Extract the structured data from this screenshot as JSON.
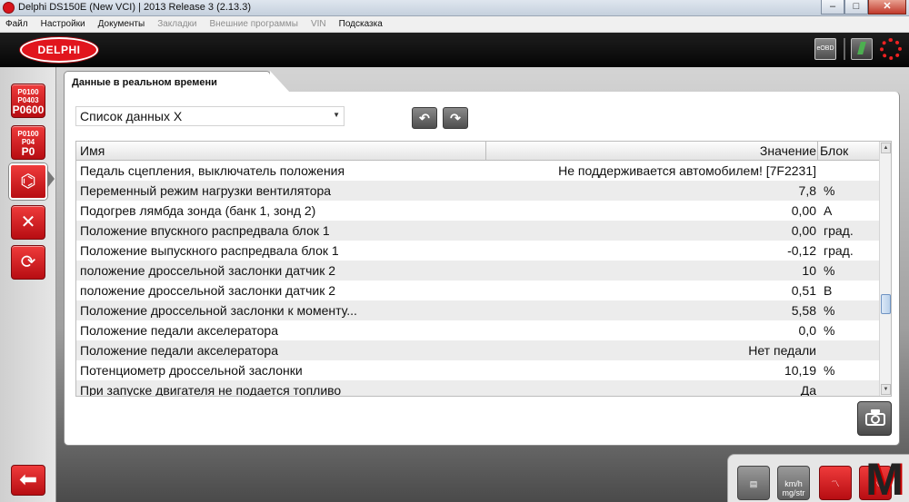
{
  "window": {
    "title": "Delphi DS150E (New VCI) | 2013 Release 3 (2.13.3)",
    "minimize": "–",
    "maximize": "□",
    "close": "✕"
  },
  "menu": [
    {
      "label": "Файл",
      "enabled": true
    },
    {
      "label": "Настройки",
      "enabled": true
    },
    {
      "label": "Документы",
      "enabled": true
    },
    {
      "label": "Закладки",
      "enabled": false
    },
    {
      "label": "Внешние программы",
      "enabled": false
    },
    {
      "label": "VIN",
      "enabled": false
    },
    {
      "label": "Подсказка",
      "enabled": true
    }
  ],
  "header": {
    "logo": "DELPHI",
    "obd_label": "eOBD"
  },
  "sidebar": {
    "dtc_read": {
      "line1": "P0100",
      "line2": "P0403",
      "line3": "P0600"
    },
    "dtc_clear": {
      "line1": "P0100",
      "line2": "P04",
      "line3": "P0"
    }
  },
  "tab": {
    "label": "Данные в реальном времени"
  },
  "selector": {
    "value": "Список данных X"
  },
  "table": {
    "columns": {
      "name": "Имя",
      "value": "Значение",
      "unit": "Блок"
    },
    "rows": [
      {
        "name": "Педаль сцепления, выключатель положения",
        "value": "Не поддерживается автомобилем! [7F2231]",
        "unit": ""
      },
      {
        "name": "Переменный режим нагрузки вентилятора",
        "value": "7,8",
        "unit": "%"
      },
      {
        "name": "Подогрев лямбда зонда (банк 1, зонд 2)",
        "value": "0,00",
        "unit": "A"
      },
      {
        "name": "Положение впускного распредвала блок 1",
        "value": "0,00",
        "unit": "град."
      },
      {
        "name": "Положение выпускного распредвала блок 1",
        "value": "-0,12",
        "unit": "град."
      },
      {
        "name": "положение дроссельной заслонки датчик 2",
        "value": "10",
        "unit": "%"
      },
      {
        "name": "положение дроссельной заслонки датчик 2",
        "value": "0,51",
        "unit": "В"
      },
      {
        "name": "Положение дроссельной заслонки к моменту...",
        "value": "5,58",
        "unit": "%"
      },
      {
        "name": "Положение педали акселератора",
        "value": "0,0",
        "unit": "%"
      },
      {
        "name": "Положение педали акселератора",
        "value": "Нет педали",
        "unit": ""
      },
      {
        "name": "Потенциометр дроссельной заслонки",
        "value": "10,19",
        "unit": "%"
      },
      {
        "name": "При запуске двигателя не подается топливо",
        "value": "Да",
        "unit": ""
      }
    ]
  },
  "toolbar": {
    "units_label": "km/h mg/str"
  },
  "watermark": "M",
  "colors": {
    "brand_red": "#e1151d",
    "header_bg": "#050505",
    "row_alt": "#ececec"
  }
}
